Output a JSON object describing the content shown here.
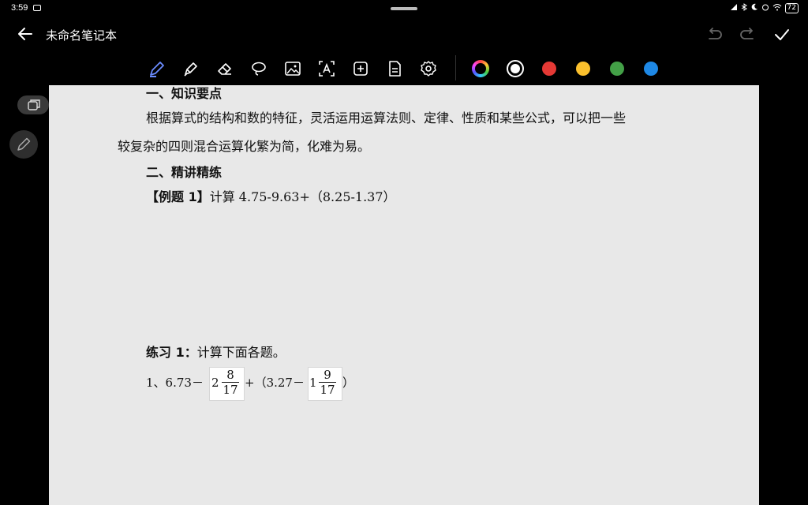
{
  "status_bar": {
    "time": "3:59",
    "battery": "72"
  },
  "header": {
    "title": "未命名笔记本"
  },
  "toolbar": {
    "tools": [
      "pen-icon",
      "highlighter-icon",
      "eraser-icon",
      "lasso-icon",
      "image-icon",
      "text-icon",
      "add-icon",
      "page-icon",
      "settings-icon"
    ],
    "colors": {
      "palette": "#ffffff",
      "selected": "#ffffff",
      "red": "#e53935",
      "yellow": "#fbc02d",
      "green": "#43a047",
      "blue": "#1e88e5"
    }
  },
  "document": {
    "heading1": "一、知识要点",
    "para1_line1": "根据算式的结构和数的特征，灵活运用运算法则、定律、性质和某些公式，可以把一些",
    "para1_line2": "较复杂的四则混合运算化繁为简，化难为易。",
    "heading2": "二、精讲精练",
    "example_label": "【例题 1】",
    "example_text": "计算 4.75-9.63+（8.25-1.37）",
    "practice_label": "练习 1：",
    "practice_text": "计算下面各题。",
    "problem1": {
      "prefix": "1、6.73－",
      "whole1": "2",
      "num1": "8",
      "den1": "17",
      "middle": "+（3.27－",
      "whole2": "1",
      "num2": "9",
      "den2": "17",
      "suffix": "）"
    }
  }
}
